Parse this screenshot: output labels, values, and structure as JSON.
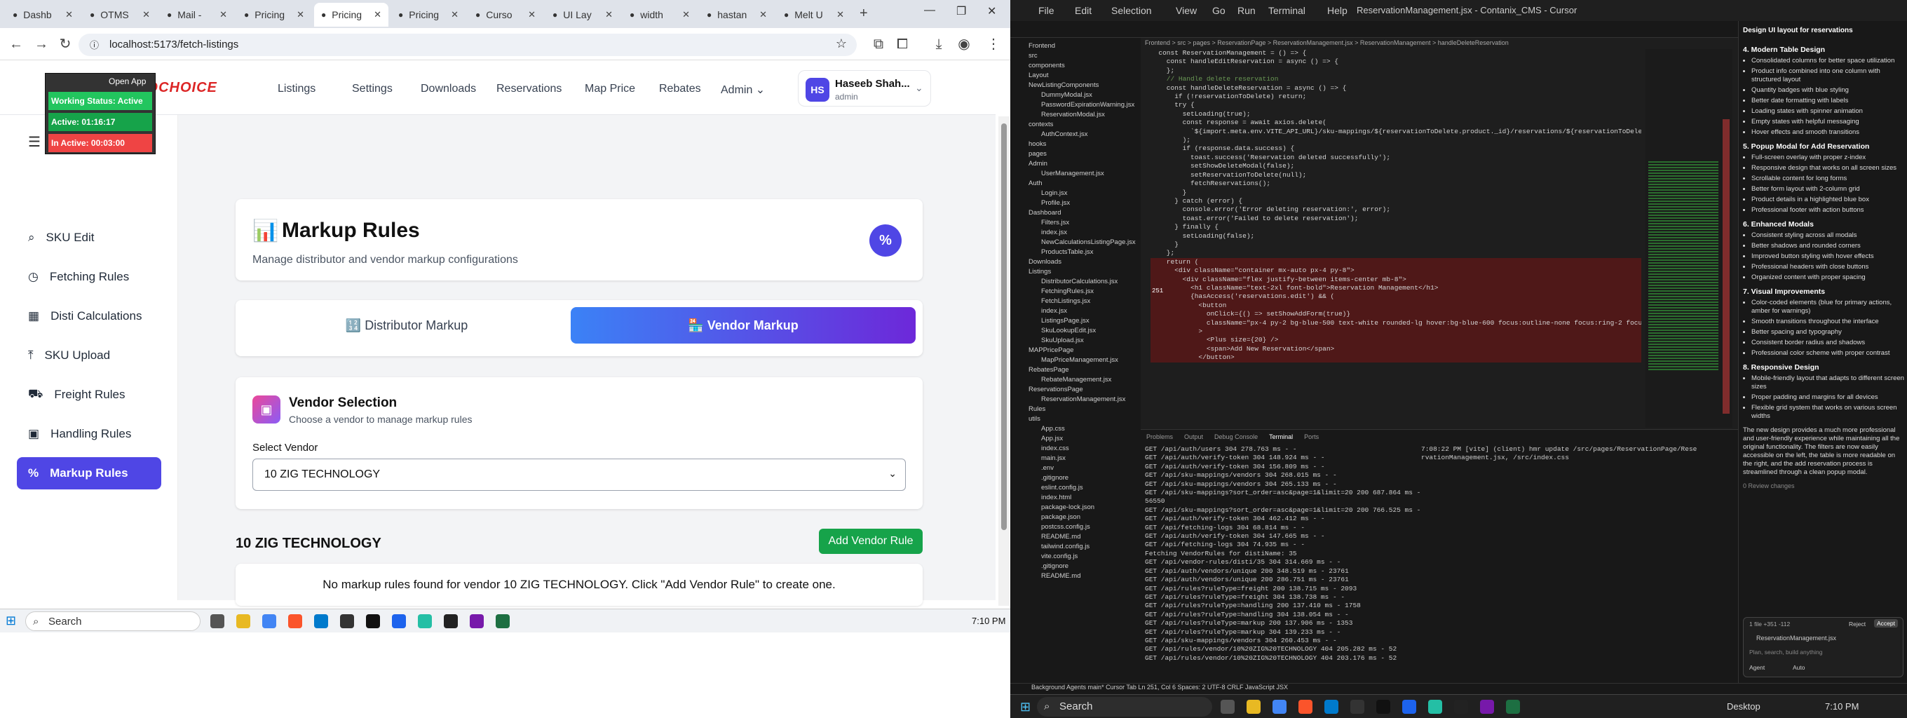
{
  "browser": {
    "tabs": [
      {
        "label": "Dashb",
        "icon": "globe"
      },
      {
        "label": "OTMS",
        "icon": "globe"
      },
      {
        "label": "Mail -",
        "icon": "mail"
      },
      {
        "label": "Pricing",
        "icon": "globe"
      },
      {
        "label": "Pricing",
        "icon": "globe",
        "active": true
      },
      {
        "label": "Pricing",
        "icon": "globe"
      },
      {
        "label": "Curso",
        "icon": "cursor"
      },
      {
        "label": "UI Lay",
        "icon": "github"
      },
      {
        "label": "width",
        "icon": "globe"
      },
      {
        "label": "hastan",
        "icon": "globe"
      },
      {
        "label": "Melt U",
        "icon": "bookmark"
      }
    ],
    "url": "localhost:5173/fetch-listings"
  },
  "popup": {
    "open_app": "Open App",
    "working_status": "Working Status: Active",
    "active": "Active: 01:16:17",
    "inactive": "In Active: 00:03:00"
  },
  "app": {
    "logo": "CLOUDCHOICE",
    "nav": [
      "Listings",
      "Settings",
      "Downloads",
      "Reservations",
      "Map Price",
      "Rebates",
      "Admin"
    ],
    "user": {
      "initials": "HS",
      "name": "Haseeb Shah...",
      "role": "admin"
    },
    "sidebar": [
      {
        "label": "SKU Edit",
        "icon": "search-icon"
      },
      {
        "label": "Fetching Rules",
        "icon": "clock-icon"
      },
      {
        "label": "Disti Calculations",
        "icon": "calculator-icon"
      },
      {
        "label": "SKU Upload",
        "icon": "upload-icon"
      },
      {
        "label": "Freight Rules",
        "icon": "truck-icon"
      },
      {
        "label": "Handling Rules",
        "icon": "package-icon"
      },
      {
        "label": "Markup Rules",
        "icon": "percent-icon",
        "active": true
      }
    ],
    "page": {
      "title": "Markup Rules",
      "subtitle": "Manage distributor and vendor markup configurations",
      "badge": "%"
    },
    "tabs": {
      "distributor": "Distributor Markup",
      "vendor": "Vendor Markup"
    },
    "vendor_selection": {
      "title": "Vendor Selection",
      "subtitle": "Choose a vendor to manage markup rules",
      "label": "Select Vendor",
      "value": "10 ZIG TECHNOLOGY"
    },
    "vendor_section": {
      "title": "10 ZIG TECHNOLOGY",
      "add_button": "Add Vendor Rule",
      "empty": "No markup rules found for vendor 10 ZIG TECHNOLOGY. Click \"Add Vendor Rule\" to create one."
    }
  },
  "taskbar_left": {
    "search": "Search",
    "time": "7:10 PM"
  },
  "editor": {
    "menu": [
      "File",
      "Edit",
      "Selection",
      "View",
      "Go",
      "Run",
      "Terminal",
      "Help"
    ],
    "title": "ReservationManagement.jsx - Contanix_CMS - Cursor",
    "breadcrumb": "Frontend > src > pages > ReservationPage > ReservationManagement.jsx > ReservationManagement > handleDeleteReservation",
    "code": [
      "  const ReservationManagement = () => {",
      "    const handleEditReservation = async () => {",
      "",
      "    };",
      "",
      "    // Handle delete reservation",
      "    const handleDeleteReservation = async () => {",
      "      if (!reservationToDelete) return;",
      "",
      "      try {",
      "        setLoading(true);",
      "        const response = await axios.delete(",
      "          `${import.meta.env.VITE_API_URL}/sku-mappings/${reservationToDelete.product._id}/reservations/${reservationToDelete.",
      "        );",
      "",
      "        if (response.data.success) {",
      "          toast.success('Reservation deleted successfully');",
      "          setShowDeleteModal(false);",
      "          setReservationToDelete(null);",
      "          fetchReservations();",
      "        }",
      "      } catch (error) {",
      "        console.error('Error deleting reservation:', error);",
      "        toast.error('Failed to delete reservation');",
      "      } finally {",
      "        setLoading(false);",
      "      }",
      "    };",
      "",
      "    return (",
      "      <div className=\"container mx-auto px-4 py-8\">",
      "        <div className=\"flex justify-between items-center mb-8\">",
      "          <h1 className=\"text-2xl font-bold\">Reservation Management</h1>",
      "          {hasAccess('reservations.edit') && (",
      "            <button",
      "              onClick={() => setShowAddForm(true)}",
      "              className=\"px-4 py-2 bg-blue-500 text-white rounded-lg hover:bg-blue-600 focus:outline-none focus:ring-2 focus:",
      "            >",
      "              <Plus size={20} />",
      "              <span>Add New Reservation</span>",
      "            </button>"
    ],
    "line_number": "251",
    "terminal": [
      "GET /api/auth/users 304 278.763 ms - -",
      "GET /api/auth/verify-token 304 148.924 ms - -",
      "GET /api/auth/verify-token 304 156.809 ms - -",
      "GET /api/sku-mappings/vendors 304 268.015 ms - -",
      "GET /api/sku-mappings/vendors 304 265.133 ms - -",
      "GET /api/sku-mappings?sort_order=asc&page=1&limit=20 200 687.864 ms -",
      "56550",
      "GET /api/sku-mappings?sort_order=asc&page=1&limit=20 200 766.525 ms -",
      "",
      "GET /api/auth/verify-token 304 462.412 ms - -",
      "GET /api/fetching-logs 304 68.814 ms - -",
      "GET /api/auth/verify-token 304 147.665 ms - -",
      "GET /api/fetching-logs 304 74.935 ms - -",
      "Fetching VendorRules for distiName: 35",
      "GET /api/vendor-rules/disti/35 304 314.669 ms - -",
      "GET /api/auth/vendors/unique 200 348.519 ms - 23761",
      "GET /api/auth/vendors/unique 200 286.751 ms - 23761",
      "GET /api/rules?ruleType=freight 200 138.715 ms - 2093",
      "GET /api/rules?ruleType=freight 304 138.738 ms - -",
      "GET /api/rules?ruleType=handling 200 137.410 ms - 1758",
      "GET /api/rules?ruleType=handling 304 138.054 ms - -",
      "GET /api/rules?ruleType=markup 200 137.906 ms - 1353",
      "GET /api/rules?ruleType=markup 304 139.233 ms - -",
      "GET /api/sku-mappings/vendors 304 260.453 ms - -",
      "GET /api/rules/vendor/10%20ZIG%20TECHNOLOGY 404 205.282 ms - 52",
      "GET /api/rules/vendor/10%20ZIG%20TECHNOLOGY 404 203.176 ms - 52"
    ],
    "terminal2": [
      "7:08:22 PM [vite] (client) hmr update /src/pages/ReservationPage/Rese",
      "rvationManagement.jsx, /src/index.css"
    ],
    "terminal_tabs": [
      "Problems",
      "Output",
      "Debug Console",
      "Terminal",
      "Ports"
    ],
    "explorer": [
      "Frontend",
      "src",
      "components",
      "Layout",
      "NewListingComponents",
      "DummyModal.jsx",
      "PasswordExpirationWarning.jsx",
      "ReservationModal.jsx",
      "contexts",
      "AuthContext.jsx",
      "hooks",
      "pages",
      "Admin",
      "UserManagement.jsx",
      "Auth",
      "Login.jsx",
      "Profile.jsx",
      "Dashboard",
      "Filters.jsx",
      "index.jsx",
      "NewCalculationsListingPage.jsx",
      "ProductsTable.jsx",
      "Downloads",
      "Listings",
      "DistributorCalculations.jsx",
      "FetchingRules.jsx",
      "FetchListings.jsx",
      "index.jsx",
      "ListingsPage.jsx",
      "SkuLookupEdit.jsx",
      "SkuUpload.jsx",
      "MAPPricePage",
      "MapPriceManagement.jsx",
      "RebatesPage",
      "RebateManagement.jsx",
      "ReservationsPage",
      "ReservationManagement.jsx",
      "Rules",
      "utils",
      "App.css",
      "App.jsx",
      "index.css",
      "main.jsx",
      ".env",
      ".gitignore",
      "eslint.config.js",
      "index.html",
      "package-lock.json",
      "package.json",
      "postcss.config.js",
      "README.md",
      "tailwind.config.js",
      "vite.config.js",
      ".gitignore",
      "README.md"
    ],
    "chat": {
      "header": "Design UI layout for reservations",
      "sections": [
        {
          "title": "4. Modern Table Design",
          "items": [
            "Consolidated columns for better space utilization",
            "Product info combined into one column with structured layout",
            "Quantity badges with blue styling",
            "Better date formatting with labels",
            "Loading states with spinner animation",
            "Empty states with helpful messaging",
            "Hover effects and smooth transitions"
          ]
        },
        {
          "title": "5. Popup Modal for Add Reservation",
          "items": [
            "Full-screen overlay with proper z-index",
            "Responsive design that works on all screen sizes",
            "Scrollable content for long forms",
            "Better form layout with 2-column grid",
            "Product details in a highlighted blue box",
            "Professional footer with action buttons"
          ]
        },
        {
          "title": "6. Enhanced Modals",
          "items": [
            "Consistent styling across all modals",
            "Better shadows and rounded corners",
            "Improved button styling with hover effects",
            "Professional headers with close buttons",
            "Organized content with proper spacing"
          ]
        },
        {
          "title": "7. Visual Improvements",
          "items": [
            "Color-coded elements (blue for primary actions, amber for warnings)",
            "Smooth transitions throughout the interface",
            "Better spacing and typography",
            "Consistent border radius and shadows",
            "Professional color scheme with proper contrast"
          ]
        },
        {
          "title": "8. Responsive Design",
          "items": [
            "Mobile-friendly layout that adapts to different screen sizes",
            "Proper padding and margins for all devices",
            "Flexible grid system that works on various screen widths"
          ]
        }
      ],
      "summary": "The new design provides a much more professional and user-friendly experience while maintaining all the original functionality. The filters are now easily accessible on the left, the table is more readable on the right, and the add reservation process is streamlined through a clean popup modal.",
      "review": "0 Review changes",
      "file_count": "1 file +351 -112",
      "reject": "Reject",
      "accept": "Accept",
      "changed_file": "ReservationManagement.jsx",
      "input_placeholder": "Plan, search, build anything",
      "agent": "Agent",
      "model": "Auto"
    },
    "statusbar": "Background Agents   main*   Cursor Tab   Ln 251, Col 6   Spaces: 2   UTF-8   CRLF   JavaScript JSX",
    "taskbar": {
      "search": "Search",
      "desktop": "Desktop",
      "time": "7:10 PM"
    }
  }
}
